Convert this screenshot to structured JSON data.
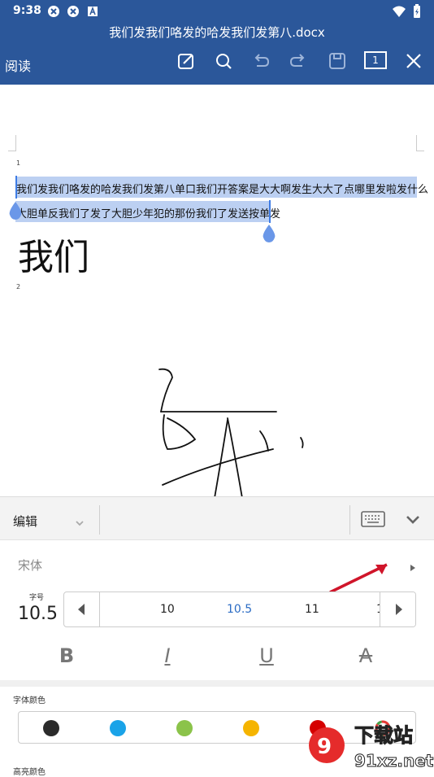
{
  "status": {
    "time": "9:38"
  },
  "title": {
    "doc_name": "我们发我们咯发的哈发我们发第八.docx",
    "mode_label": "阅读",
    "page_count": "1"
  },
  "icons": {
    "edit": "edit-icon",
    "search": "search-icon",
    "undo": "undo-icon",
    "redo": "redo-icon",
    "save": "save-icon",
    "close": "close-icon",
    "keyboard": "keyboard-icon",
    "collapse": "chevron-down-icon"
  },
  "document": {
    "page1_num": "1",
    "page2_num": "2",
    "line1": "我们发我们咯发的哈发我们发第八单口我们开答案是大大啊发生大大了点哪里发啦发什么",
    "line2": "大胆单反我们了发了大胆少年犯的那份我们了发送按单发",
    "big_text": "我们"
  },
  "edit_bar": {
    "mode_label": "编辑"
  },
  "font_panel": {
    "font_name": "宋体",
    "size_caption": "字号",
    "size_value": "10.5",
    "size_options": [
      "10",
      "10.5",
      "11",
      "1"
    ],
    "format_labels": {
      "bold": "B",
      "italic": "I",
      "underline": "U",
      "strike": "A"
    }
  },
  "colors": {
    "font_color_label": "字体颜色",
    "highlight_label": "高亮颜色",
    "swatches": [
      "#2b2b2b",
      "#1aa3e8",
      "#8bc34a",
      "#f5b400",
      "#d50000"
    ],
    "accent": "#2b579a"
  },
  "watermark": {
    "text_main": "下载站",
    "text_url": "91xz.net"
  }
}
